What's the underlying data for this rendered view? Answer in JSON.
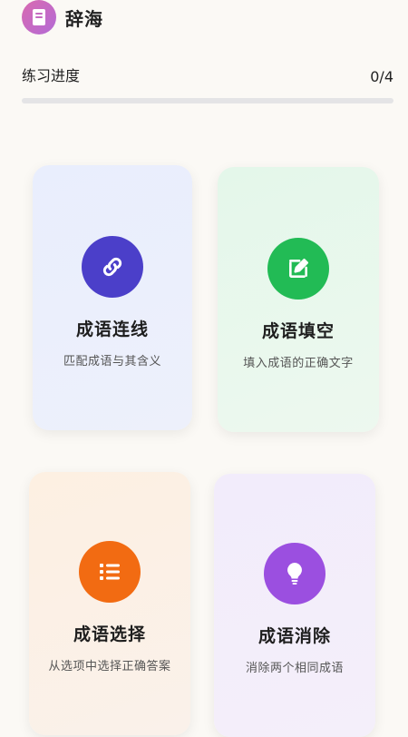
{
  "header": {
    "title": "辞海",
    "icon": "book-icon"
  },
  "progress": {
    "label": "练习进度",
    "value_text": "0/4",
    "fraction": 0
  },
  "colors": {
    "match": "#4b3fc9",
    "fill": "#22bb55",
    "choice": "#f26b12",
    "eliminate": "#9b4fe0"
  },
  "cards": {
    "match": {
      "title": "成语连线",
      "subtitle": "匹配成语与其含义",
      "icon": "link-icon"
    },
    "fill": {
      "title": "成语填空",
      "subtitle": "填入成语的正确文字",
      "icon": "edit-icon"
    },
    "choice": {
      "title": "成语选择",
      "subtitle": "从选项中选择正确答案",
      "icon": "list-icon"
    },
    "eliminate": {
      "title": "成语消除",
      "subtitle": "消除两个相同成语",
      "icon": "lightbulb-icon"
    }
  }
}
